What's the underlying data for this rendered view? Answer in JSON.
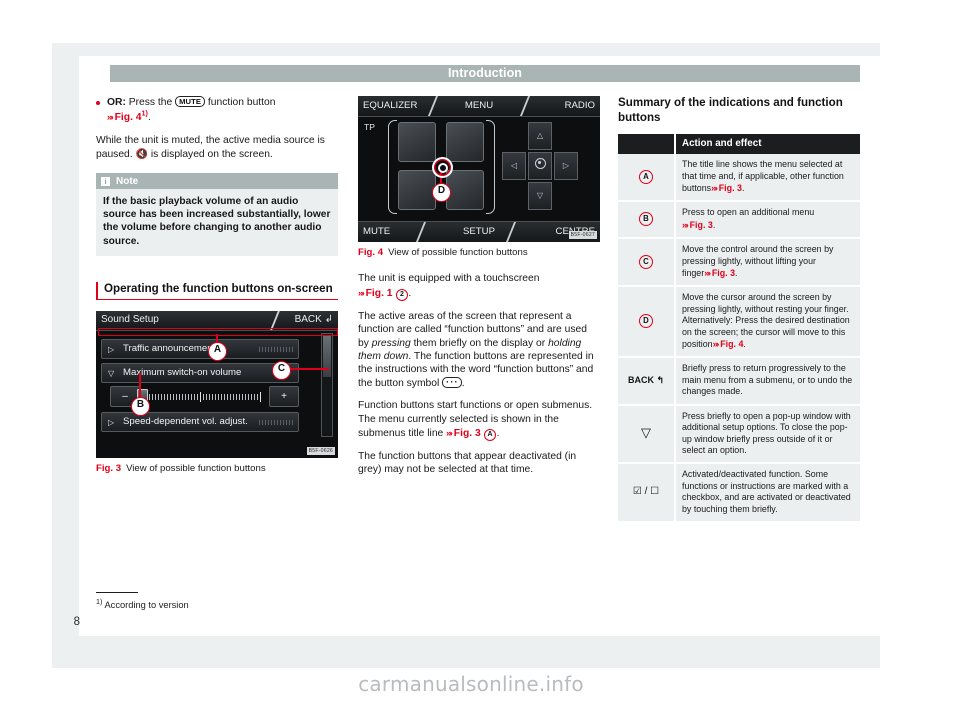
{
  "header": {
    "title": "Introduction"
  },
  "page_number": "8",
  "watermark": "carmanualsonline.info",
  "footnote": {
    "marker": "1)",
    "text": "According to version"
  },
  "column1": {
    "bullet": {
      "lead": "OR:",
      "text_before_key": "Press the",
      "keycap": "MUTE",
      "text_after_key": "function button",
      "reference": "Fig. 4",
      "reference_sup": "1)"
    },
    "paragraph_1_part_a": "While the unit is muted, the active media source is paused.",
    "paragraph_1_mute_icon": "mute-speaker-icon",
    "paragraph_1_part_b": "is displayed on the screen.",
    "note": {
      "icon": "info-icon",
      "title": "Note",
      "body": "If the basic playback volume of an audio source has been increased substantially, lower the volume before changing to another audio source."
    },
    "section_heading": "Operating the function buttons on-screen",
    "figure3": {
      "fig_label": "Fig. 3",
      "caption": "View of possible function buttons",
      "code": "B5F-0626",
      "screen": {
        "title": "Sound Setup",
        "back_label": "BACK",
        "rows": [
          {
            "arrow": "▷",
            "label": "Traffic announcements",
            "value": ""
          },
          {
            "arrow": "▽",
            "label": "Maximum switch-on volume",
            "value": "6"
          },
          {
            "arrow": "▷",
            "label": "Speed-dependent vol. adjust.",
            "value": ""
          }
        ],
        "minus": "–",
        "plus": "+"
      },
      "markers": [
        "A",
        "B",
        "C"
      ]
    }
  },
  "column2": {
    "figure4": {
      "fig_label": "Fig. 4",
      "caption": "View of possible function buttons",
      "code": "B5F-0627",
      "screen": {
        "top_left": "EQUALIZER",
        "top_center": "MENU",
        "top_right": "RADIO",
        "bottom_left": "MUTE",
        "bottom_center": "SETUP",
        "bottom_right": "CENTRE",
        "tp": "TP",
        "dpad": {
          "up": "△",
          "down": "▽",
          "left": "◁",
          "right": "▷",
          "ok": "ok-ring-icon"
        }
      },
      "markers": [
        "D"
      ]
    },
    "paragraph_1_part_a": "The unit is equipped with a touchscreen",
    "paragraph_1_reference": "Fig. 1",
    "paragraph_1_marker": "2",
    "paragraph_2_a": "The active areas of the screen that represent a function are called “function buttons” and are used by",
    "paragraph_2_i1": "pressing",
    "paragraph_2_b": "them briefly on the display or",
    "paragraph_2_i2": "holding them down",
    "paragraph_2_c": ". The function buttons are represented in the instructions with the word “function buttons” and the button symbol",
    "paragraph_2_keycap": "···",
    "paragraph_2_d": ".",
    "paragraph_3_a": "Function buttons start functions or open submenus. The menu currently selected is shown in the submenus title line",
    "paragraph_3_reference": "Fig. 3",
    "paragraph_3_marker": "A",
    "paragraph_4": "The function buttons that appear deactivated (in grey) may not be selected at that time."
  },
  "column3": {
    "heading": "Summary of the indications and function buttons",
    "table": {
      "headers": [
        "",
        "Action and effect"
      ],
      "rows": [
        {
          "symbol_type": "circled",
          "symbol": "A",
          "text_a": "The title line shows the menu selected at that time and, if applicable, other function buttons",
          "reference": "Fig. 3",
          "text_b": "."
        },
        {
          "symbol_type": "circled",
          "symbol": "B",
          "text_a": "Press to open an additional menu",
          "reference": "Fig. 3",
          "text_b": "."
        },
        {
          "symbol_type": "circled",
          "symbol": "C",
          "text_a": "Move the control around the screen by pressing lightly, without lifting your finger",
          "reference": "Fig. 3",
          "text_b": "."
        },
        {
          "symbol_type": "circled",
          "symbol": "D",
          "text_a": "Move the cursor around the screen by pressing lightly, without resting your finger. Alternatively: Press the desired destination on the screen; the cursor will move to this position",
          "reference": "Fig. 4",
          "text_b": "."
        },
        {
          "symbol_type": "back",
          "symbol": "BACK  ↰",
          "text_a": "Briefly press to return progressively to the main menu from a submenu, or to undo the changes made.",
          "reference": "",
          "text_b": ""
        },
        {
          "symbol_type": "triangle",
          "symbol": "▽",
          "text_a": "Press briefly to open a pop-up window with additional setup options. To close the pop-up window briefly press outside of it or select an option.",
          "reference": "",
          "text_b": ""
        },
        {
          "symbol_type": "checkbox",
          "symbol": "☑ / ☐",
          "text_a": "Activated/deactivated function. Some functions or instructions are marked with a checkbox, and are activated or deactivated by touching them briefly.",
          "reference": "",
          "text_b": ""
        }
      ]
    }
  },
  "colors": {
    "accent_red": "#e1001a",
    "header_band": "#a8b5b4",
    "note_bg": "#eceff0",
    "table_header": "#1b1d1f"
  }
}
